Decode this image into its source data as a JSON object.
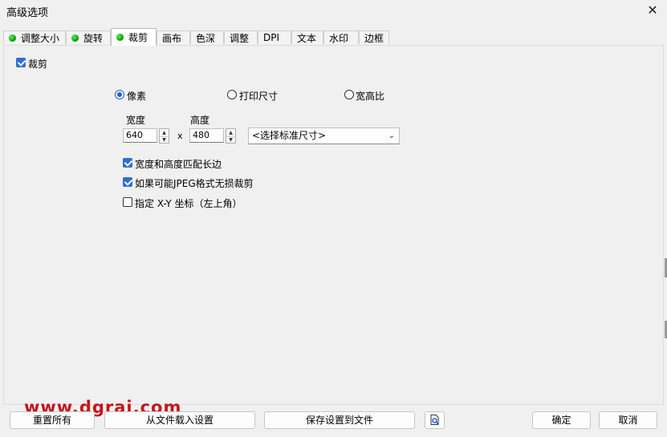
{
  "window": {
    "title": "高级选项",
    "close_icon": "close-icon"
  },
  "tabs": [
    {
      "label": "调整大小",
      "indicator": true,
      "active": false
    },
    {
      "label": "旋转",
      "indicator": true,
      "active": false
    },
    {
      "label": "裁剪",
      "indicator": true,
      "active": true
    },
    {
      "label": "画布",
      "indicator": false,
      "active": false
    },
    {
      "label": "色深",
      "indicator": false,
      "active": false
    },
    {
      "label": "调整",
      "indicator": false,
      "active": false
    },
    {
      "label": "DPI",
      "indicator": false,
      "active": false
    },
    {
      "label": "文本",
      "indicator": false,
      "active": false
    },
    {
      "label": "水印",
      "indicator": false,
      "active": false
    },
    {
      "label": "边框",
      "indicator": false,
      "active": false
    }
  ],
  "crop": {
    "enable": {
      "label": "裁剪",
      "checked": true
    },
    "mode": {
      "options": [
        {
          "label": "像素",
          "selected": true
        },
        {
          "label": "打印尺寸",
          "selected": false
        },
        {
          "label": "宽高比",
          "selected": false
        }
      ]
    },
    "width": {
      "label": "宽度",
      "value": "640"
    },
    "height": {
      "label": "高度",
      "value": "480"
    },
    "separator": "x",
    "standard_size": {
      "value": "<选择标准尺寸>"
    },
    "options": [
      {
        "label": "宽度和高度匹配长边",
        "checked": true
      },
      {
        "label": "如果可能JPEG格式无损裁剪",
        "checked": true
      },
      {
        "label": "指定 X-Y 坐标（左上角）",
        "checked": false
      }
    ]
  },
  "footer": {
    "reset_all": "重置所有",
    "load_settings": "从文件载入设置",
    "save_settings": "保存设置到文件",
    "preview_icon": "preview-icon",
    "ok": "确定",
    "cancel": "取消"
  },
  "watermark": "www.dgrai.com",
  "colors": {
    "accent": "#1f5fc8",
    "indicator": "#0aa10a",
    "watermark": "#c4161c"
  }
}
